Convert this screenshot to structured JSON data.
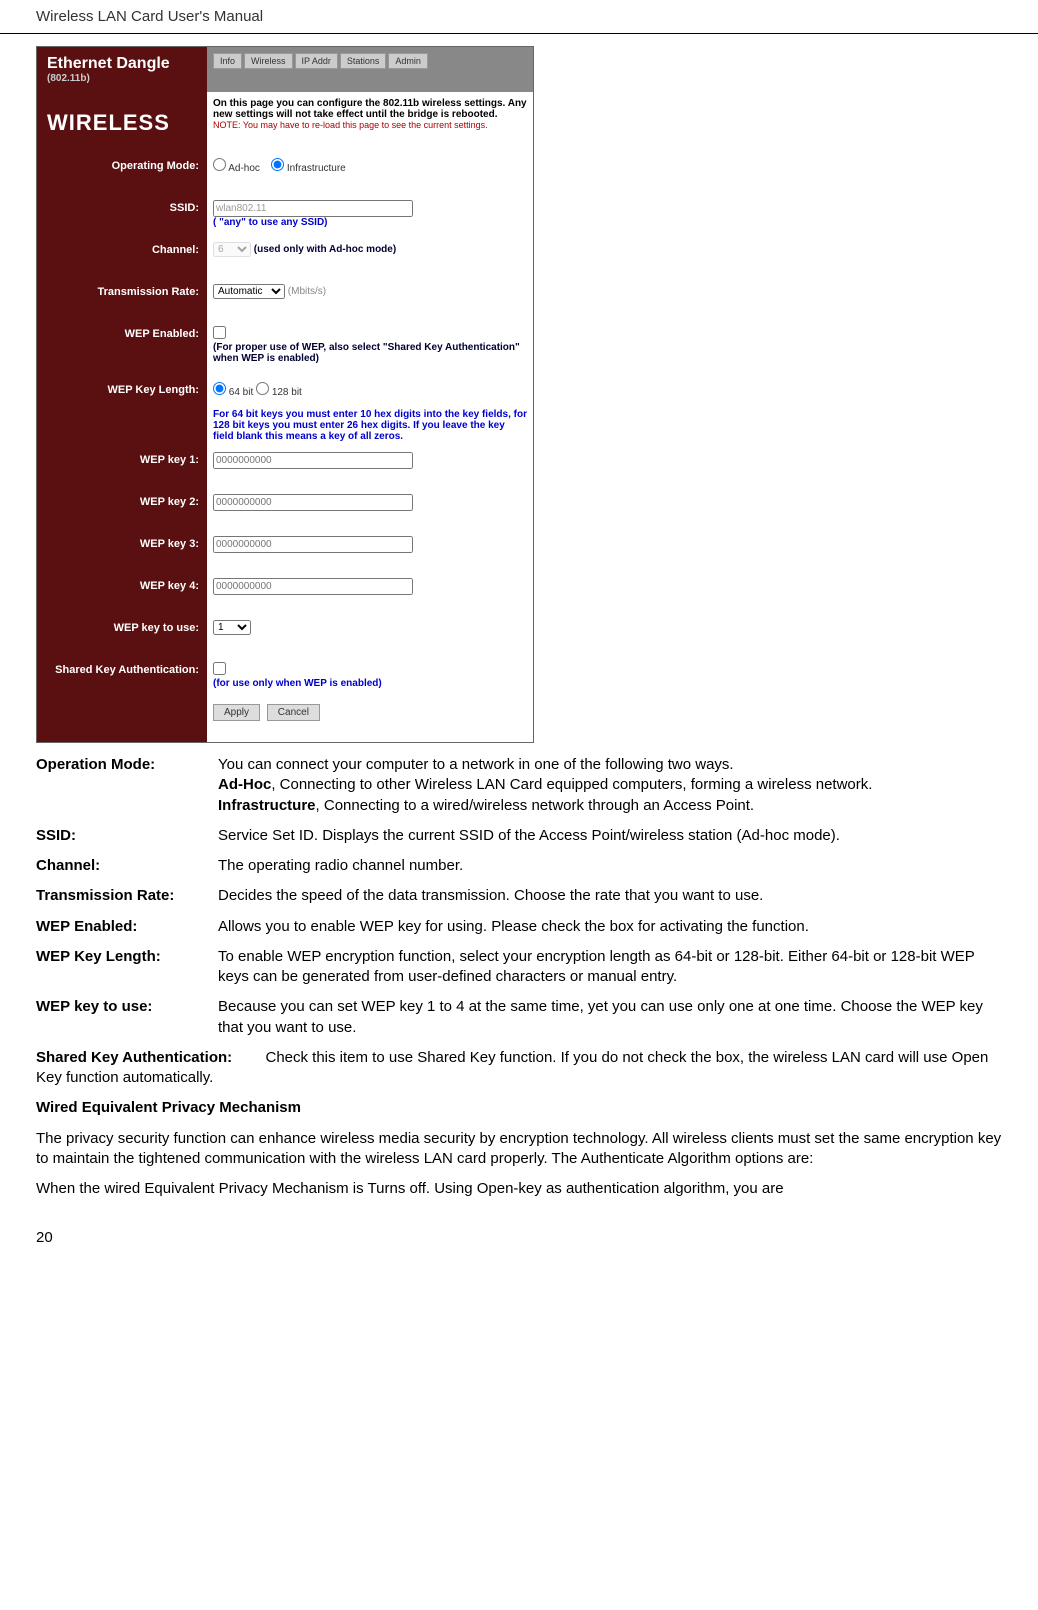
{
  "header": {
    "title": "Wireless LAN Card User's Manual"
  },
  "screenshot": {
    "device": "Ethernet Dangle",
    "device_sub": "(802.11b)",
    "tabs": [
      "Info",
      "Wireless",
      "IP Addr",
      "Stations",
      "Admin"
    ],
    "section": "WIRELESS",
    "intro": "On this page you can configure the 802.11b wireless settings. Any new settings will not take effect until the bridge is rebooted.",
    "intro_note": "NOTE: You may have to re-load this page to see the current settings.",
    "rows": {
      "operating_mode": {
        "label": "Operating Mode:",
        "opt_adhoc": "Ad-hoc",
        "opt_infra": "Infrastructure"
      },
      "ssid": {
        "label": "SSID:",
        "value": "wlan802.11",
        "hint": "( \"any\" to use any SSID)"
      },
      "channel": {
        "label": "Channel:",
        "value": "6",
        "hint": "(used only with Ad-hoc mode)"
      },
      "trans_rate": {
        "label": "Transmission Rate:",
        "value": "Automatic",
        "unit": "(Mbits/s)"
      },
      "wep_enabled": {
        "label": "WEP Enabled:",
        "hint": "(For proper use of WEP, also select \"Shared   Key Authentication\" when WEP is enabled)"
      },
      "wep_key_length": {
        "label": "WEP Key Length:",
        "opt64": "64 bit",
        "opt128": "128 bit",
        "hint": "For 64 bit keys you must enter 10 hex digits into the key fields, for 128 bit keys you must enter 26 hex digits. If you leave the key field blank this means a key of all zeros."
      },
      "wep_key_1": {
        "label": "WEP key 1:",
        "placeholder": "0000000000"
      },
      "wep_key_2": {
        "label": "WEP key 2:",
        "placeholder": "0000000000"
      },
      "wep_key_3": {
        "label": "WEP key 3:",
        "placeholder": "0000000000"
      },
      "wep_key_4": {
        "label": "WEP key 4:",
        "placeholder": "0000000000"
      },
      "wep_key_use": {
        "label": "WEP key to use:",
        "value": "1"
      },
      "shared_key": {
        "label": "Shared Key Authentication:",
        "hint": "(for use only when WEP is enabled)"
      },
      "buttons": {
        "apply": "Apply",
        "cancel": "Cancel"
      }
    }
  },
  "definitions": {
    "operation_mode": {
      "label": "Operation Mode:",
      "line1": "You can connect your computer to a network in one of the following two ways.",
      "adhoc_label": "Ad-Hoc",
      "adhoc_text": ", Connecting to other Wireless LAN Card equipped computers, forming a wireless network.",
      "infra_label": "Infrastructure",
      "infra_text": ", Connecting to a wired/wireless network through an Access Point."
    },
    "ssid": {
      "label": "SSID:",
      "text": "Service Set ID. Displays the current SSID of the Access Point/wireless station (Ad-hoc mode)."
    },
    "channel": {
      "label": "Channel:",
      "text": "The operating radio channel number."
    },
    "transmission_rate": {
      "label": "Transmission Rate:",
      "text": "Decides the speed of the data transmission. Choose the rate that you want to use."
    },
    "wep_enabled": {
      "label": "WEP Enabled:",
      "text": "Allows you to enable WEP key for using. Please check the box for activating the function."
    },
    "wep_key_length": {
      "label": "WEP Key Length:",
      "text": "To enable WEP encryption function, select your encryption length as 64-bit or 128-bit. Either 64-bit or 128-bit WEP keys can be generated from user-defined characters or manual entry."
    },
    "wep_key_to_use": {
      "label": "WEP key to use:",
      "text": "Because you can set WEP key 1 to 4 at the same time, yet you can use only one at one time. Choose the WEP key that you want to use."
    },
    "shared_key_auth": {
      "label": "Shared Key Authentication:",
      "text": "Check this item to use Shared Key function. If you do not check the box, the wireless LAN card will use Open Key function automatically."
    },
    "wep_mechanism_heading": "Wired Equivalent Privacy Mechanism",
    "wep_mechanism_p1": "The privacy security function can enhance wireless media security by encryption technology. All wireless clients must set the same encryption key to maintain the tightened communication with the wireless LAN card properly. The Authenticate Algorithm options are:",
    "wep_mechanism_p2": "When the wired Equivalent Privacy Mechanism is Turns off. Using Open-key as authentication algorithm, you are"
  },
  "page_number": "20"
}
